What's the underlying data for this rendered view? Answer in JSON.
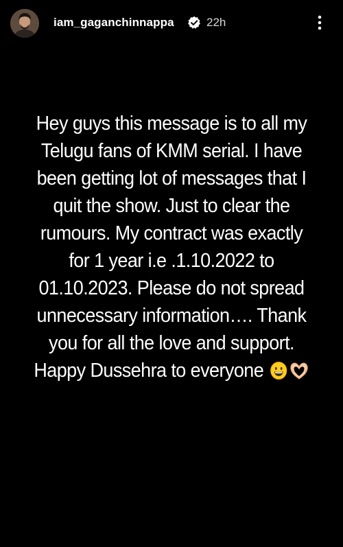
{
  "header": {
    "username": "iam_gaganchinnappa",
    "time": "22h",
    "avatar_icon": "profile-photo",
    "verified_icon": "verified-badge-icon",
    "more_icon": "more-vertical-icon"
  },
  "story": {
    "lines": [
      "Hey guys this message is to all my",
      "Telugu fans of KMM serial. I have",
      "been getting lot of messages that I",
      "quit the show. Just to clear the",
      "rumours. My contract was exactly",
      "for 1 year i.e .1.10.2022 to",
      "01.10.2023. Please do not spread",
      "unnecessary information…. Thank",
      "you for all the love and support.",
      "Happy Dussehra to everyone"
    ],
    "emojis": [
      "grinning-face-emoji",
      "heart-hands-emoji"
    ]
  },
  "colors": {
    "background": "#000000",
    "text": "#ffffff",
    "verified_badge": "#ffffff"
  }
}
